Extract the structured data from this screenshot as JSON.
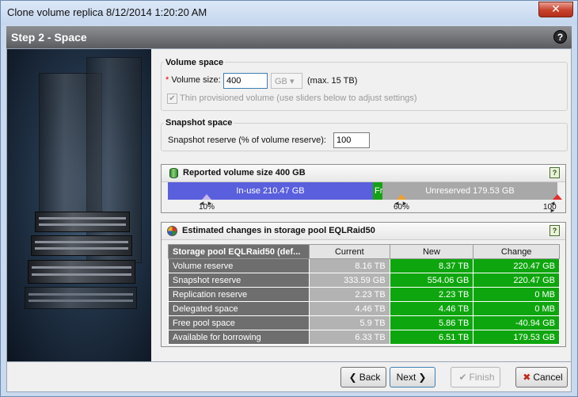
{
  "window": {
    "title": "Clone volume replica 8/12/2014 1:20:20 AM",
    "close_glyph": "✕"
  },
  "step": {
    "title": "Step 2 - Space",
    "help_glyph": "?"
  },
  "volume_space": {
    "title": "Volume space",
    "size_required": "*",
    "size_label": "Volume size:",
    "size_value": "400",
    "unit": "GB",
    "unit_arrow": "▾",
    "max_text": "(max. 15 TB)",
    "thin_label": "Thin provisioned volume (use sliders below to adjust settings)",
    "thin_checked": true
  },
  "snapshot_space": {
    "title": "Snapshot space",
    "reserve_label": "Snapshot reserve (% of volume reserve):",
    "reserve_value": "100"
  },
  "reported": {
    "title": "Reported volume size 400 GB",
    "help_glyph": "?",
    "inuse_label": "In-use 210.47 GB",
    "free_label": "Fr",
    "unreserved_label": "Unreserved 179.53 GB",
    "inuse_fraction": 0.52617,
    "free_fraction": 0.025,
    "markers": [
      {
        "label": "10%",
        "color": "#c8b7e6",
        "value": 0.1
      },
      {
        "label": "60%",
        "color": "#f0a030",
        "value": 0.6
      },
      {
        "label": "100",
        "color": "#e0302a",
        "value": 1.0
      }
    ],
    "colors": {
      "inuse": "#5a5fdd",
      "free": "#16a116",
      "unreserved": "#a8a8a8"
    }
  },
  "estimated": {
    "title": "Estimated changes in storage pool EQLRaid50",
    "help_glyph": "?",
    "columns": [
      "Storage pool EQLRaid50 (def...",
      "Current",
      "New",
      "Change"
    ],
    "rows": [
      {
        "name": "Volume reserve",
        "current": "8.16 TB",
        "new": "8.37 TB",
        "change": "220.47 GB"
      },
      {
        "name": "Snapshot reserve",
        "current": "333.59 GB",
        "new": "554.06 GB",
        "change": "220.47 GB"
      },
      {
        "name": "Replication reserve",
        "current": "2.23 TB",
        "new": "2.23 TB",
        "change": "0 MB"
      },
      {
        "name": "Delegated space",
        "current": "4.46 TB",
        "new": "4.46 TB",
        "change": "0 MB"
      },
      {
        "name": "Free pool space",
        "current": "5.9 TB",
        "new": "5.86 TB",
        "change": "-40.94 GB"
      },
      {
        "name": "Available for borrowing",
        "current": "6.33 TB",
        "new": "6.51 TB",
        "change": "179.53 GB"
      }
    ],
    "colors": {
      "header": "#6e6e6e",
      "current": "#b3b3b3",
      "new": "#0ea60e"
    }
  },
  "footer": {
    "back_label": "Back",
    "back_glyph": "❮",
    "next_label": "Next",
    "next_glyph": "❯",
    "finish_label": "Finish",
    "finish_glyph": "✔",
    "cancel_label": "Cancel",
    "cancel_glyph": "✖"
  }
}
